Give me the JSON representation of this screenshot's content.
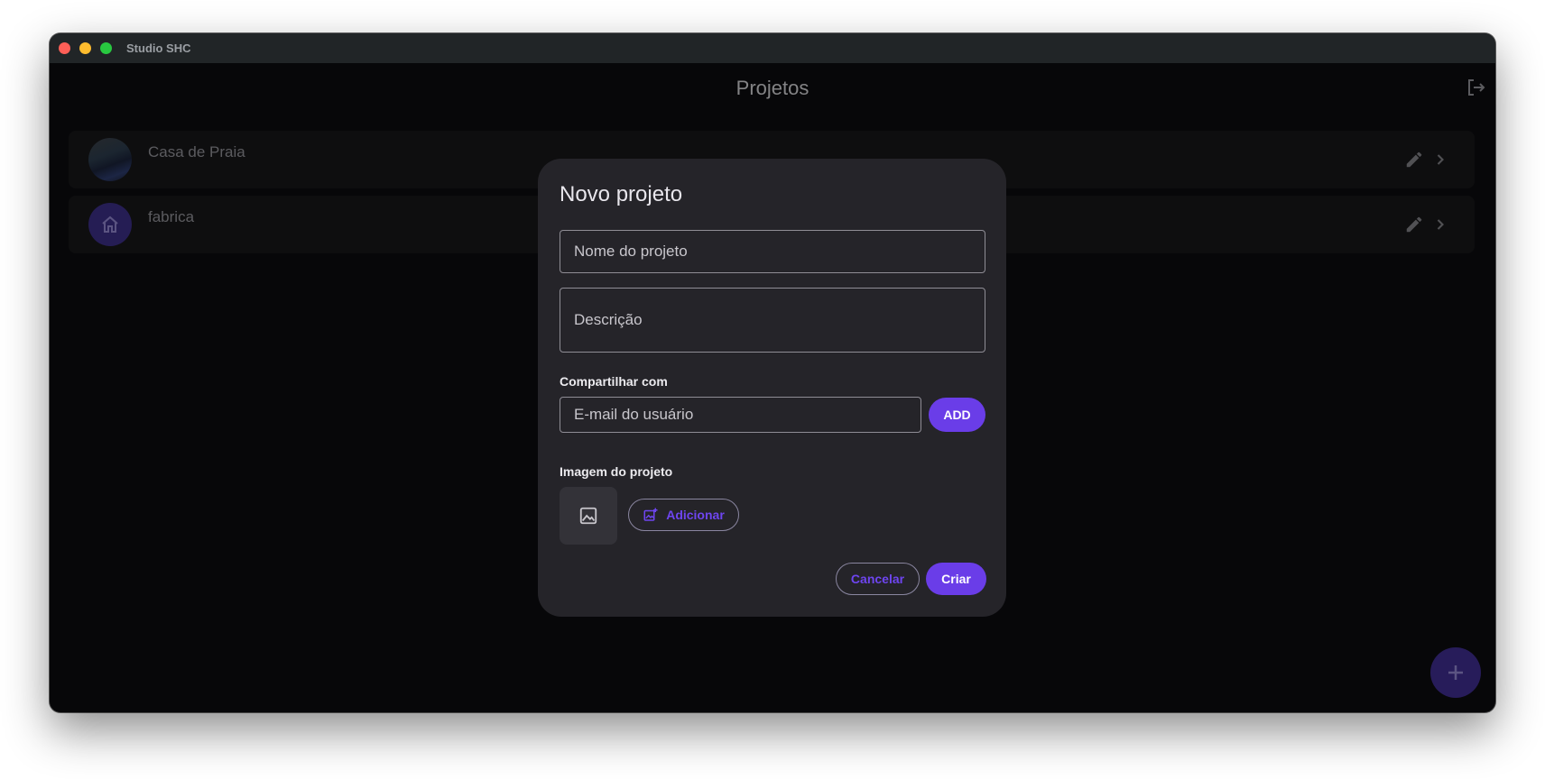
{
  "window": {
    "title": "Studio SHC"
  },
  "appbar": {
    "title": "Projetos",
    "logout_icon": "logout-icon"
  },
  "projects": [
    {
      "name": "Casa de Praia",
      "avatar": "photo"
    },
    {
      "name": "fabrica",
      "avatar": "home-icon"
    }
  ],
  "dialog": {
    "title": "Novo projeto",
    "name_placeholder": "Nome do projeto",
    "description_placeholder": "Descrição",
    "share_label": "Compartilhar com",
    "email_placeholder": "E-mail do usuário",
    "add_label": "ADD",
    "image_label": "Imagem do projeto",
    "add_image_label": "Adicionar",
    "cancel_label": "Cancelar",
    "create_label": "Criar"
  },
  "colors": {
    "accent": "#6a3de8",
    "background": "#0c0c0e",
    "dialog": "#252429"
  }
}
